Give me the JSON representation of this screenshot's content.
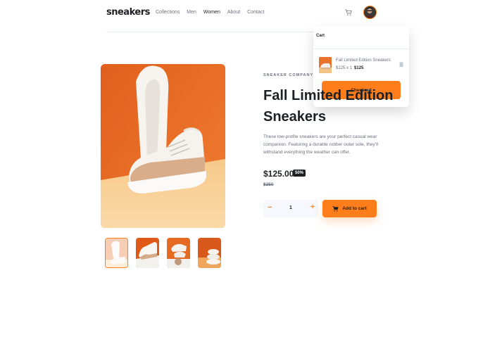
{
  "header": {
    "logo": "sneakers",
    "nav": [
      "Collections",
      "Men",
      "Women",
      "About",
      "Contact"
    ],
    "icons": {
      "cart": "cart-icon",
      "avatar": "user-avatar"
    }
  },
  "cart": {
    "title": "Cart",
    "item": {
      "name": "Fall Limited Edition Sneakers",
      "unit_line": "$125 x 1",
      "total": "$125"
    },
    "checkout_label": "Checkout"
  },
  "product": {
    "company": "SNEAKER COMPANY",
    "title": "Fall Limited Edition Sneakers",
    "description": "These low-profile sneakers are your perfect casual wear companion. Featuring a durable rubber outer sole, they’ll withstand everything the weather can offer.",
    "price": "$125.00",
    "discount": "50%",
    "old_price": "$250",
    "quantity": "1",
    "qty_minus": "−",
    "qty_plus": "+",
    "add_label": "Add to cart"
  },
  "colors": {
    "accent": "#ff7e1b",
    "dark": "#1d2025",
    "muted": "#69707d"
  }
}
